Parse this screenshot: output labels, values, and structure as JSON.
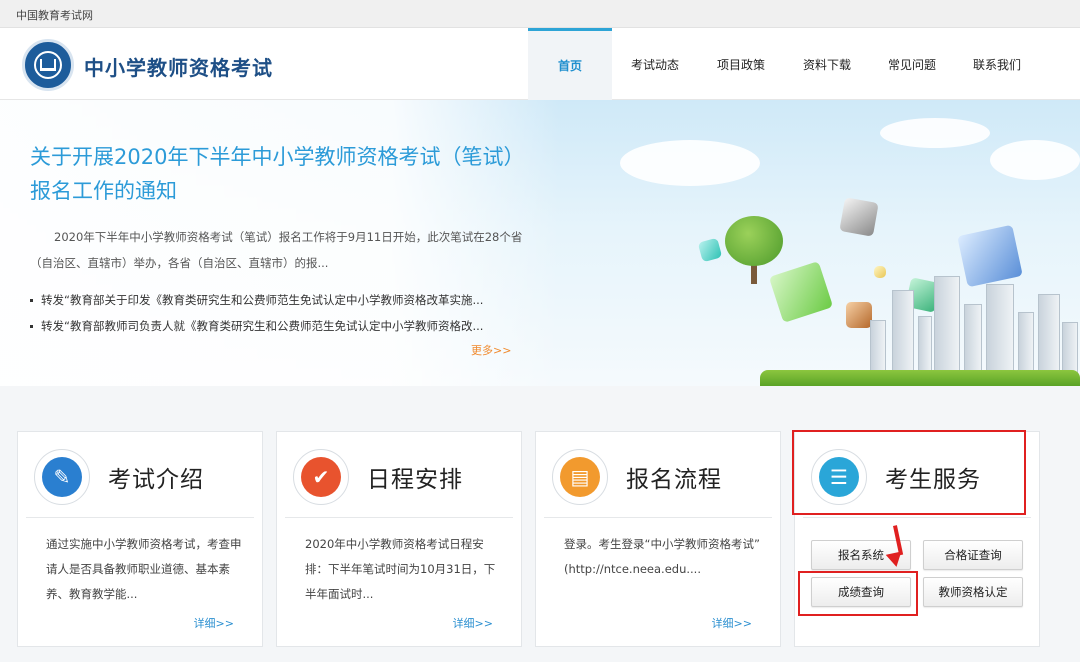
{
  "topbar": {
    "site_name": "中国教育考试网"
  },
  "header": {
    "title": "中小学教师资格考试",
    "nav": [
      {
        "label": "首页",
        "active": true
      },
      {
        "label": "考试动态",
        "active": false
      },
      {
        "label": "项目政策",
        "active": false
      },
      {
        "label": "资料下载",
        "active": false
      },
      {
        "label": "常见问题",
        "active": false
      },
      {
        "label": "联系我们",
        "active": false
      }
    ]
  },
  "banner": {
    "headline": "关于开展2020年下半年中小学教师资格考试（笔试）报名工作的通知",
    "summary": "2020年下半年中小学教师资格考试（笔试）报名工作将于9月11日开始，此次笔试在28个省（自治区、直辖市）举办，各省（自治区、直辖市）的报...",
    "news": [
      "转发“教育部关于印发《教育类研究生和公费师范生免试认定中小学教师资格改革实施...",
      "转发“教育部教师司负责人就《教育类研究生和公费师范生免试认定中小学教师资格改..."
    ],
    "more_label": "更多>>"
  },
  "cards": {
    "intro": {
      "title": "考试介绍",
      "text": "通过实施中小学教师资格考试，考查申请人是否具备教师职业道德、基本素养、教育教学能...",
      "more": "详细>>"
    },
    "schedule": {
      "title": "日程安排",
      "text": "2020年中小学教师资格考试日程安排：下半年笔试时间为10月31日，下半年面试时...",
      "more": "详细>>"
    },
    "process": {
      "title": "报名流程",
      "text": "登录。考生登录“中小学教师资格考试” (http://ntce.neea.edu....",
      "more": "详细>>"
    },
    "service": {
      "title": "考生服务",
      "buttons": {
        "register": "报名系统",
        "admission": "合格证查询",
        "score": "成绩查询",
        "certify": "教师资格认定"
      }
    }
  },
  "colors": {
    "accent": "#2da4d6",
    "brand": "#1e4f86",
    "highlight": "#e02020",
    "more_link": "#f08a2e"
  }
}
